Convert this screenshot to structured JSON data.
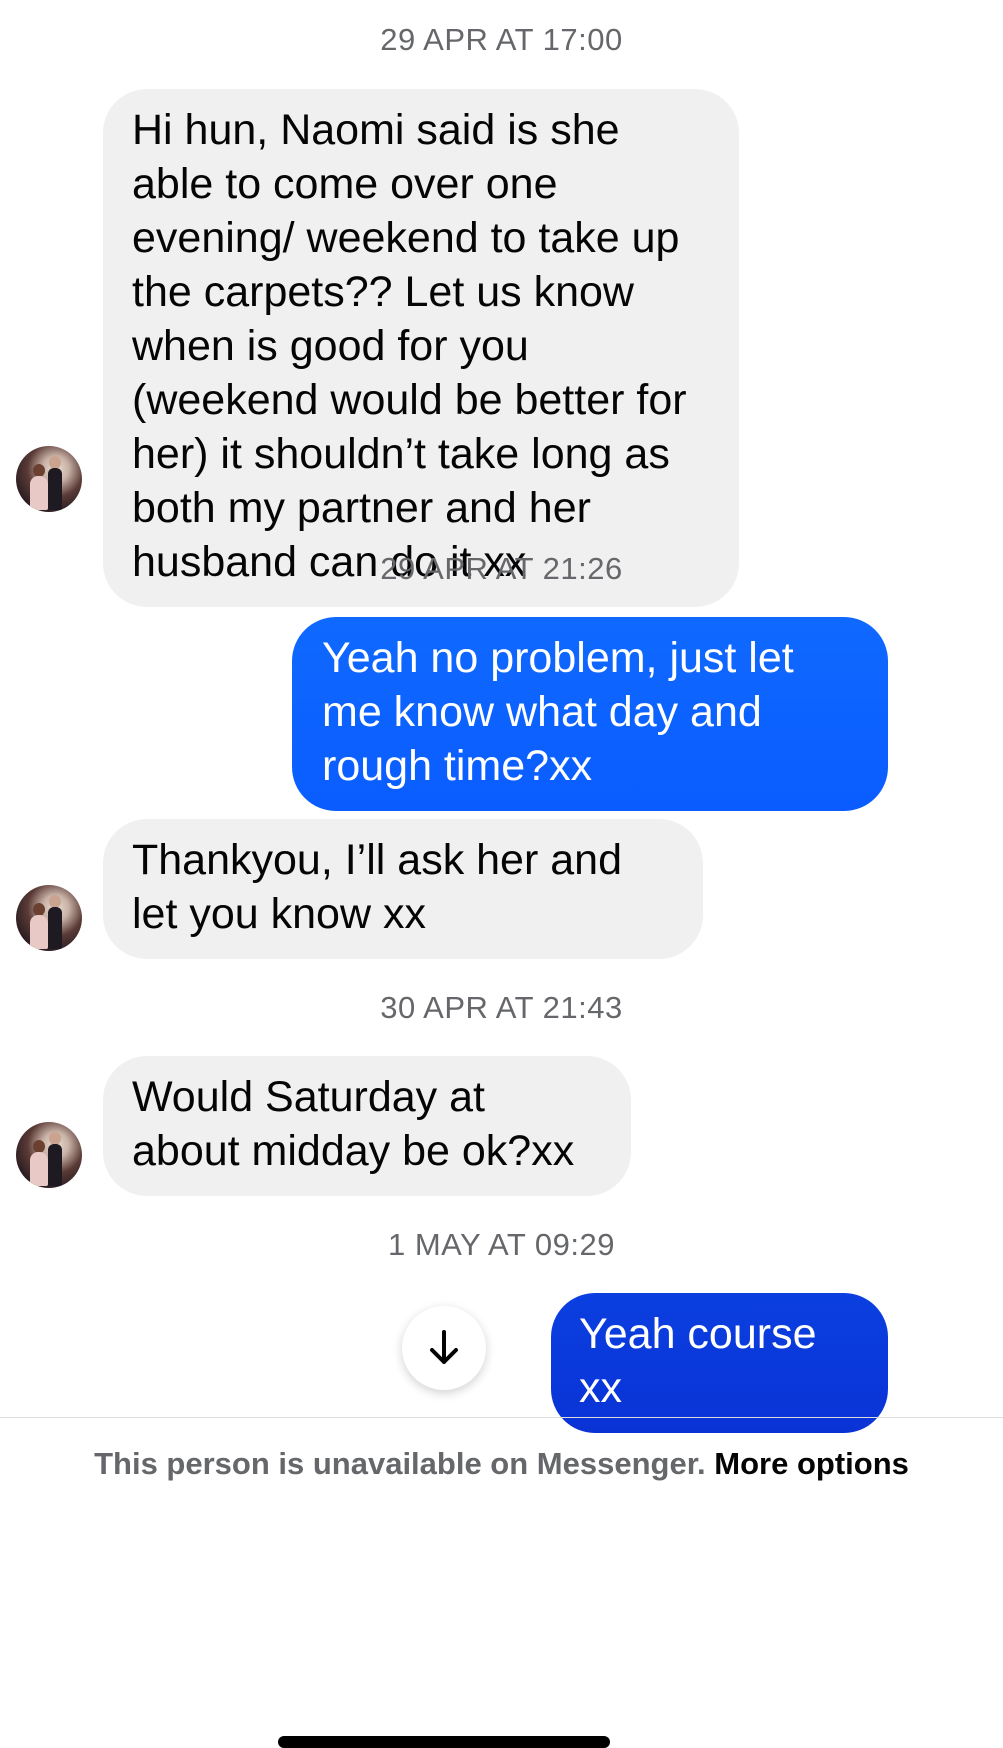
{
  "conversation": {
    "timestamps": [
      "29 APR AT 17:00",
      "29 APR AT 21:26",
      "30 APR AT 21:43",
      "1 MAY AT 09:29"
    ],
    "messages": [
      {
        "direction": "incoming",
        "text": "Hi hun, Naomi said is she able to come over one evening/ weekend to take up the carpets?? Let us know when is good for you (weekend would be better for her) it shouldn’t take long as both my partner and her husband can do it xx"
      },
      {
        "direction": "outgoing",
        "text": "Yeah no problem, just let me know what day and rough time?xx"
      },
      {
        "direction": "incoming",
        "text": "Thankyou, I’ll ask her and let you know xx"
      },
      {
        "direction": "incoming",
        "text": "Would Saturday at about midday be ok?xx"
      },
      {
        "direction": "outgoing",
        "text": "Yeah course xx"
      }
    ]
  },
  "footer": {
    "notice": "This person is unavailable on Messenger.",
    "more_options": "More options"
  },
  "icons": {
    "scroll_down": "arrow-down-icon",
    "avatar": "contact-avatar"
  },
  "colors": {
    "incoming_bubble": "#f0f0f0",
    "outgoing_bubble": "#0a5cff",
    "outgoing_bubble_last": "#0a33d6",
    "timestamp_text": "#65676b"
  }
}
